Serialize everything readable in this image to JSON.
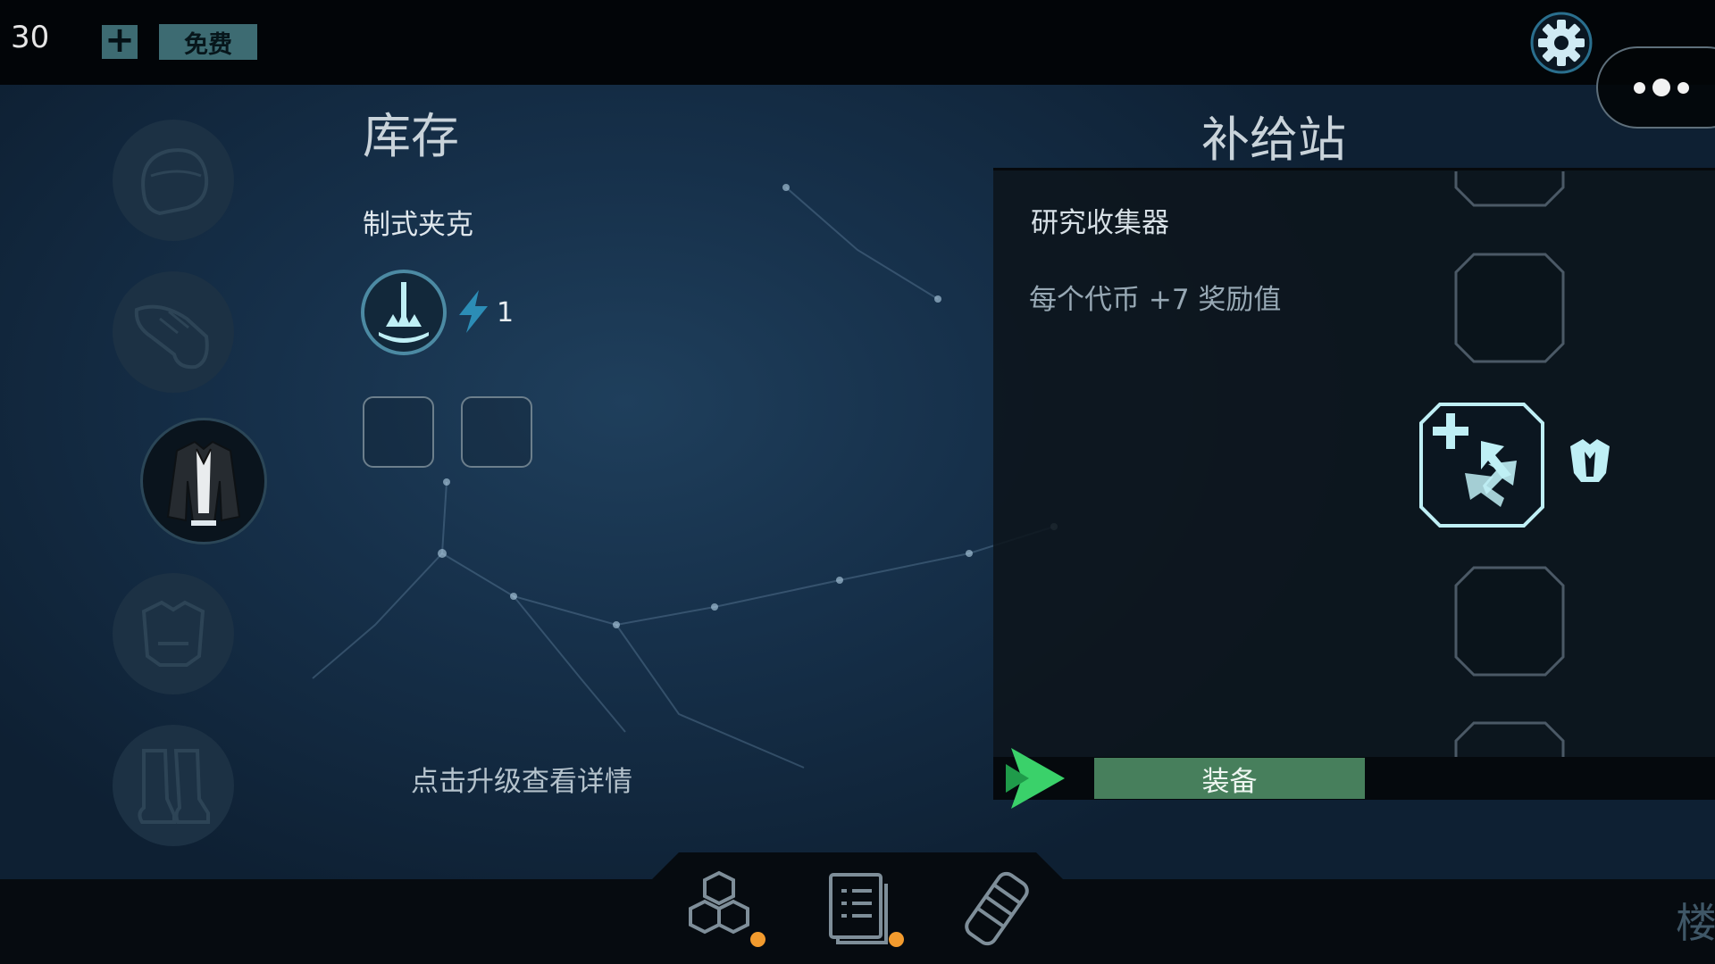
{
  "top_bar": {
    "level": "30",
    "plus_icon": "plus-icon",
    "free_label": "免费",
    "settings_icon": "gear-icon",
    "more_icon": "more-dots-icon"
  },
  "categories": [
    {
      "name": "helmet",
      "icon": "helmet-icon",
      "selected": false
    },
    {
      "name": "gloves",
      "icon": "glove-icon",
      "selected": false
    },
    {
      "name": "jacket",
      "icon": "jacket-icon",
      "selected": true
    },
    {
      "name": "chest-armor",
      "icon": "chest-armor-icon",
      "selected": false
    },
    {
      "name": "boots",
      "icon": "boots-icon",
      "selected": false
    }
  ],
  "inventory": {
    "title": "库存",
    "item_name": "制式夹克",
    "ability_icon": "ground-strike-icon",
    "energy_icon": "lightning-icon",
    "energy_value": "1",
    "mod_slots": 2,
    "hint": "点击升级查看详情"
  },
  "supply": {
    "title": "补给站",
    "item_label": "研究收集器",
    "item_desc": "每个代币 +7 奖励值",
    "selected_icon": "research-collector-icon",
    "item_type_icon": "chest-armor-icon",
    "equip_label": "装备",
    "play_icon": "play-arrow-icon"
  },
  "bottom_nav": {
    "items": [
      {
        "icon": "cubes-icon",
        "badge": true
      },
      {
        "icon": "document-list-icon",
        "badge": true
      },
      {
        "icon": "canister-icon",
        "badge": false
      }
    ],
    "floor_label": "楼"
  },
  "colors": {
    "accent_teal": "#3d6b72",
    "equip_green": "#477f5c",
    "badge_orange": "#f29b2e",
    "highlight_cyan": "#bfeff5"
  }
}
